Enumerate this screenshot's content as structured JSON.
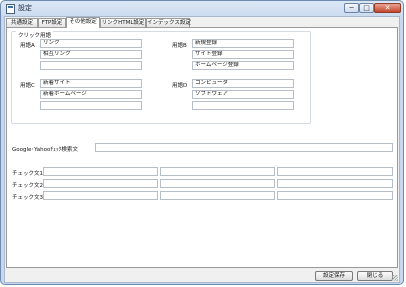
{
  "window": {
    "title": "設定",
    "min_label": "─",
    "max_label": "□",
    "close_label": "✕"
  },
  "tabs": [
    {
      "label": "共通設定"
    },
    {
      "label": "FTP設定"
    },
    {
      "label": "その他設定"
    },
    {
      "label": "リンクHTML設定"
    },
    {
      "label": "インデックス設定"
    }
  ],
  "click_terms": {
    "group_title": "クリック用語",
    "A": {
      "label": "用語A",
      "values": [
        "リンク",
        "相互リンク",
        ""
      ]
    },
    "B": {
      "label": "用語B",
      "values": [
        "新規登録",
        "サイト登録",
        "ホームページ登録"
      ]
    },
    "C": {
      "label": "用語C",
      "values": [
        "新着サイト",
        "新着ホームページ",
        ""
      ]
    },
    "D": {
      "label": "用語D",
      "values": [
        "コンピュータ",
        "ソフトウェア",
        ""
      ]
    }
  },
  "google_check": {
    "label": "Google･Yahooﾁｪｯｸ検索文",
    "value": ""
  },
  "checks": [
    {
      "label": "チェック文1",
      "values": [
        "",
        "",
        ""
      ]
    },
    {
      "label": "チェック文2",
      "values": [
        "",
        "",
        ""
      ]
    },
    {
      "label": "チェック文3",
      "values": [
        "",
        "",
        ""
      ]
    }
  ],
  "buttons": {
    "save_label": "設定保存",
    "close_label": "閉じる"
  },
  "colors": {
    "titlebar": "#c7d8ee",
    "close_button": "#c4452c",
    "panel": "#ffffff"
  }
}
